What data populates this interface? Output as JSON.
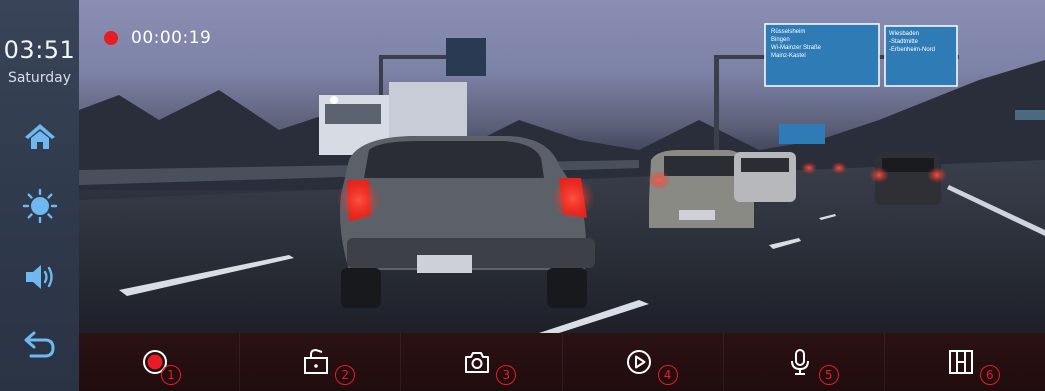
{
  "status": {
    "time": "03:51",
    "day": "Saturday"
  },
  "recording": {
    "elapsed": "00:00:19",
    "dot_color": "#e81c24"
  },
  "sidebar": {
    "buttons": [
      {
        "icon": "home-icon"
      },
      {
        "icon": "brightness-icon"
      },
      {
        "icon": "volume-icon"
      },
      {
        "icon": "back-icon"
      }
    ]
  },
  "toolbar": {
    "items": [
      {
        "icon": "record-icon",
        "badge": "1"
      },
      {
        "icon": "lock-file-icon",
        "badge": "2"
      },
      {
        "icon": "camera-icon",
        "badge": "3"
      },
      {
        "icon": "playback-icon",
        "badge": "4"
      },
      {
        "icon": "microphone-icon",
        "badge": "5"
      },
      {
        "icon": "split-view-icon",
        "badge": "6"
      }
    ]
  },
  "road_signs": {
    "left_sign": [
      "Rüsselsheim",
      "Bingen",
      "Wi-Mainzer Straße",
      "Mainz-Kastel"
    ],
    "right_sign": [
      "Wiesbaden",
      "-Stadtmitte",
      "-Erbenheim-Nord"
    ]
  },
  "colors": {
    "accent": "#e81c24",
    "sidebar_icon": "#6fb8f0",
    "toolbar_bg": "#200c0e"
  }
}
